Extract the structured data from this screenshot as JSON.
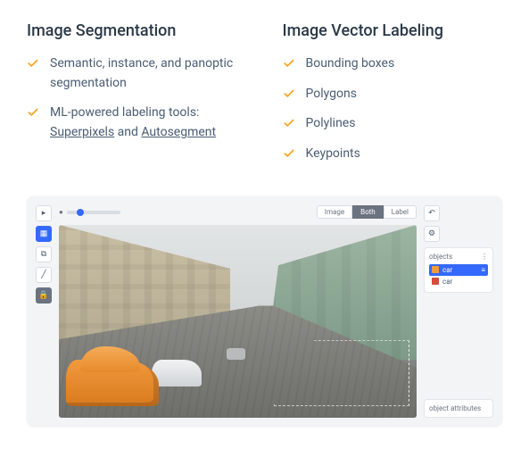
{
  "columns": [
    {
      "title": "Image Segmentation",
      "items": [
        {
          "prefix": "Semantic, instance, and panoptic segmentation"
        },
        {
          "prefix": "ML-powered labeling tools: ",
          "link1": "Superpixels",
          "mid": " and ",
          "link2": "Autosegment"
        }
      ]
    },
    {
      "title": "Image Vector Labeling",
      "items": [
        {
          "prefix": "Bounding boxes"
        },
        {
          "prefix": "Polygons"
        },
        {
          "prefix": "Polylines"
        },
        {
          "prefix": "Keypoints"
        }
      ]
    }
  ],
  "editor": {
    "tabs": {
      "t1": "Image",
      "t2": "Both",
      "t3": "Label"
    },
    "objectsPanel": {
      "title": "objects",
      "items": [
        {
          "label": "car",
          "color": "orange",
          "selected": true
        },
        {
          "label": "car",
          "color": "red",
          "selected": false
        }
      ]
    },
    "attributesPanel": {
      "title": "object attributes"
    }
  }
}
